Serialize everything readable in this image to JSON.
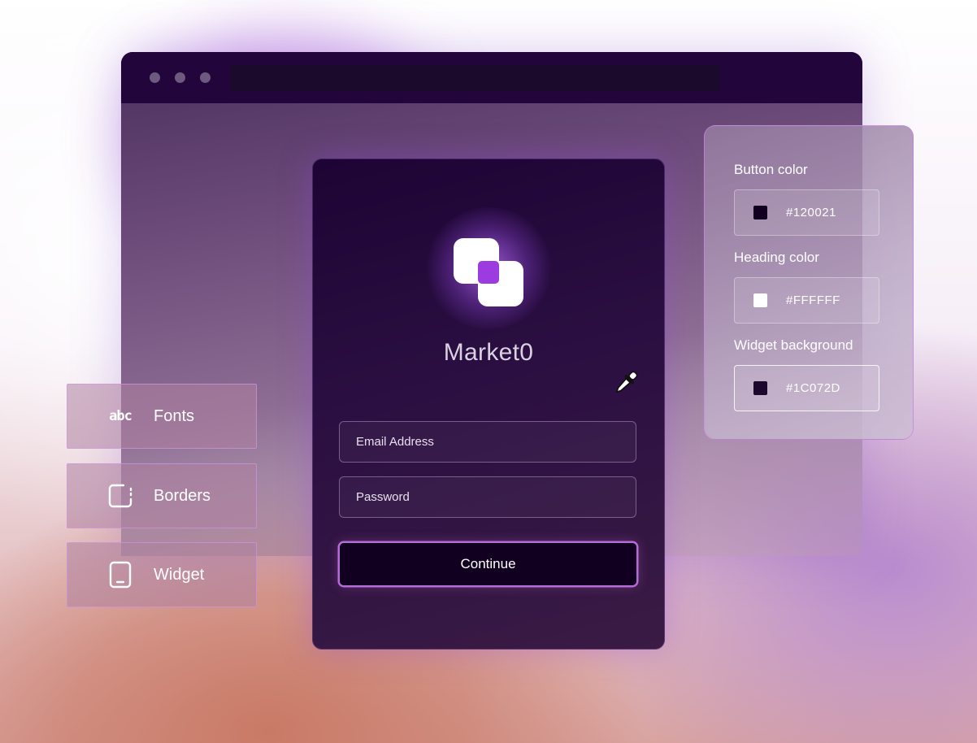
{
  "login_card": {
    "brand": "Market0",
    "email_placeholder": "Email Address",
    "password_placeholder": "Password",
    "continue_label": "Continue"
  },
  "color_panel": {
    "items": [
      {
        "label": "Button color",
        "hex": "#120021",
        "swatch": "#120021"
      },
      {
        "label": "Heading color",
        "hex": "#FFFFFF",
        "swatch": "#FFFFFF"
      },
      {
        "label": "Widget background",
        "hex": "#1C072D",
        "swatch": "#1C072D"
      }
    ]
  },
  "tools": [
    {
      "label": "Fonts",
      "icon": "abc-icon",
      "glyph": "abc"
    },
    {
      "label": "Borders",
      "icon": "border-icon"
    },
    {
      "label": "Widget",
      "icon": "tablet-icon"
    }
  ],
  "icons": {
    "eyedropper": "eyedropper-icon",
    "logo": "market0-logo-icon"
  },
  "colors": {
    "card_bg": "#1D0435",
    "browser_bar": "#22053B",
    "button": "#120021",
    "accent_purple": "#9B3BE0"
  }
}
